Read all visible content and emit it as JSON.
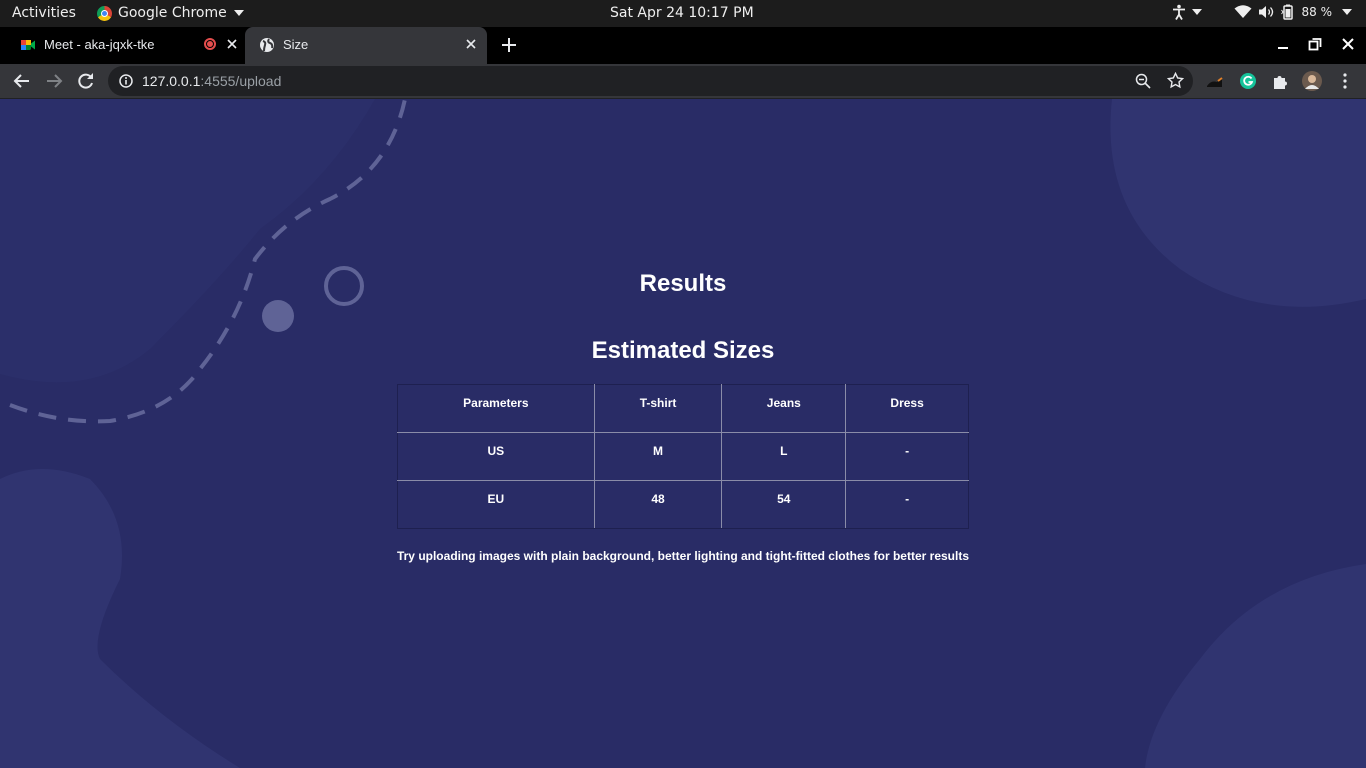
{
  "system_bar": {
    "activities": "Activities",
    "app_name": "Google Chrome",
    "clock": "Sat Apr 24  10:17 PM",
    "battery": "88 %"
  },
  "tabs": [
    {
      "title": "Meet - aka-jqxk-tke",
      "active": false,
      "icon": "google-meet-icon",
      "recording": true
    },
    {
      "title": "Size",
      "active": true,
      "icon": "globe-icon"
    }
  ],
  "address_bar": {
    "host": "127.0.0.1",
    "rest": ":4555/upload"
  },
  "page": {
    "title": "Results",
    "section_title": "Estimated Sizes",
    "table": {
      "headers": [
        "Parameters",
        "T-shirt",
        "Jeans",
        "Dress"
      ],
      "rows": [
        [
          "US",
          "M",
          "L",
          "-"
        ],
        [
          "EU",
          "48",
          "54",
          "-"
        ]
      ]
    },
    "hint": "Try uploading images with plain background, better lighting and tight-fitted clothes for better results"
  },
  "colors": {
    "page_bg": "#292c66",
    "blob": "#303470",
    "dashes": "#5f6396"
  }
}
